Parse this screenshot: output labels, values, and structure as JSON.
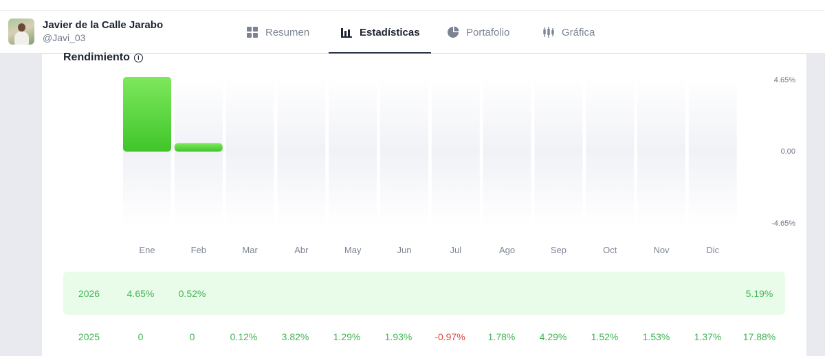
{
  "user": {
    "name": "Javier de la Calle Jarabo",
    "handle": "@Javi_03"
  },
  "tabs": [
    {
      "label": "Resumen",
      "icon": "grid-icon"
    },
    {
      "label": "Estadísticas",
      "icon": "bar-chart-icon",
      "active": true
    },
    {
      "label": "Portafolio",
      "icon": "pie-chart-icon"
    },
    {
      "label": "Gráfica",
      "icon": "candlestick-icon"
    }
  ],
  "section": {
    "title": "Rendimiento",
    "info_icon": "i"
  },
  "chart_data": {
    "type": "bar",
    "categories": [
      "Ene",
      "Feb",
      "Mar",
      "Abr",
      "May",
      "Jun",
      "Jul",
      "Ago",
      "Sep",
      "Oct",
      "Nov",
      "Dic"
    ],
    "values": [
      4.65,
      0.52,
      null,
      null,
      null,
      null,
      null,
      null,
      null,
      null,
      null,
      null
    ],
    "ylim": [
      -4.65,
      4.65
    ],
    "yticks": [
      "4.65%",
      "0.00",
      "-4.65%"
    ],
    "bar_color": "#4cd23f"
  },
  "table": {
    "rows": [
      {
        "year": "2026",
        "months": [
          "4.65%",
          "0.52%",
          "",
          "",
          "",
          "",
          "",
          "",
          "",
          "",
          "",
          ""
        ],
        "total": "5.19%",
        "highlight": true
      },
      {
        "year": "2025",
        "months": [
          "0",
          "0",
          "0.12%",
          "3.82%",
          "1.29%",
          "1.93%",
          "-0.97%",
          "1.78%",
          "4.29%",
          "1.52%",
          "1.53%",
          "1.37%"
        ],
        "total": "17.88%",
        "highlight": false
      }
    ]
  },
  "colors": {
    "positive": "#3db550",
    "negative": "#e0453d",
    "highlight_bg": "#e9fbe9"
  }
}
